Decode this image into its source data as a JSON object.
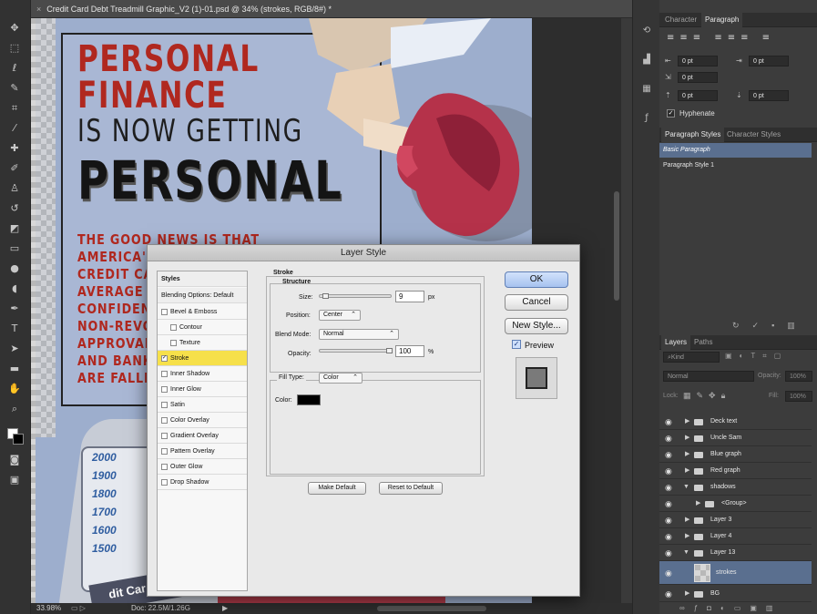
{
  "document": {
    "tab_close": "×",
    "title": "Credit Card Debt Treadmill Graphic_V2 (1)-01.psd @ 34% (strokes, RGB/8#) *"
  },
  "artwork": {
    "line1": "PERSONAL",
    "line2": "FINANCE",
    "line3": "IS NOW GETTING",
    "line4": "PERSONAL",
    "body_lines": [
      "THE GOOD NEWS IS THAT AMERICA'S",
      "CREDIT CARD",
      "AVERAGE ANI",
      "CONFIDENCE",
      "NON-REVOLVI",
      "APPROVALS I",
      "AND BANKRU",
      "ARE FALLING"
    ],
    "years": [
      "2000",
      "1900",
      "1800",
      "1700",
      "1600",
      "1500"
    ],
    "card_text": "dit Car"
  },
  "status": {
    "zoom": "33.98%",
    "doc": "Doc: 22.5M/1.26G"
  },
  "character_panel": {
    "tabs": [
      "Character",
      "Paragraph"
    ],
    "fields": [
      "0 pt",
      "0 pt",
      "0 pt",
      "0 pt",
      "0 pt"
    ],
    "hyphenate": "Hyphenate"
  },
  "paragraph_styles": {
    "tabs": [
      "Paragraph Styles",
      "Character Styles"
    ],
    "items": [
      "Basic Paragraph",
      "Paragraph Style 1"
    ]
  },
  "layers_panel": {
    "tabs": [
      "Layers",
      "Paths"
    ],
    "kind": "Kind",
    "blend": "Normal",
    "opacity_label": "Opacity:",
    "opacity": "100%",
    "lock_label": "Lock:",
    "fill_label": "Fill:",
    "fill": "100%",
    "layers": [
      {
        "name": "Deck text"
      },
      {
        "name": "Uncle Sam"
      },
      {
        "name": "Blue graph"
      },
      {
        "name": "Red graph"
      },
      {
        "name": "shadows"
      },
      {
        "name": "<Group>"
      },
      {
        "name": "Layer 3"
      },
      {
        "name": "Layer 4"
      },
      {
        "name": "Layer 13"
      },
      {
        "name": "strokes"
      },
      {
        "name": "BG"
      }
    ]
  },
  "dialog": {
    "title": "Layer Style",
    "styles_header": "Styles",
    "blending_options": "Blending Options: Default",
    "style_items": [
      "Bevel & Emboss",
      "Contour",
      "Texture",
      "Stroke",
      "Inner Shadow",
      "Inner Glow",
      "Satin",
      "Color Overlay",
      "Gradient Overlay",
      "Pattern Overlay",
      "Outer Glow",
      "Drop Shadow"
    ],
    "stroke_header": "Stroke",
    "structure_header": "Structure",
    "size_label": "Size:",
    "size_value": "9",
    "size_unit": "px",
    "position_label": "Position:",
    "position_value": "Center",
    "blend_mode_label": "Blend Mode:",
    "blend_mode_value": "Normal",
    "opacity_label": "Opacity:",
    "opacity_value": "100",
    "opacity_unit": "%",
    "fill_type_label": "Fill Type:",
    "fill_type_value": "Color",
    "color_label": "Color:",
    "make_default": "Make Default",
    "reset_default": "Reset to Default",
    "ok": "OK",
    "cancel": "Cancel",
    "new_style": "New Style...",
    "preview": "Preview",
    "checkmark": "✓",
    "caret": "⌃"
  },
  "colors": {
    "stroke_color": "#000000",
    "selected_style": "#f6e04a",
    "title_red": "#b0281f"
  }
}
